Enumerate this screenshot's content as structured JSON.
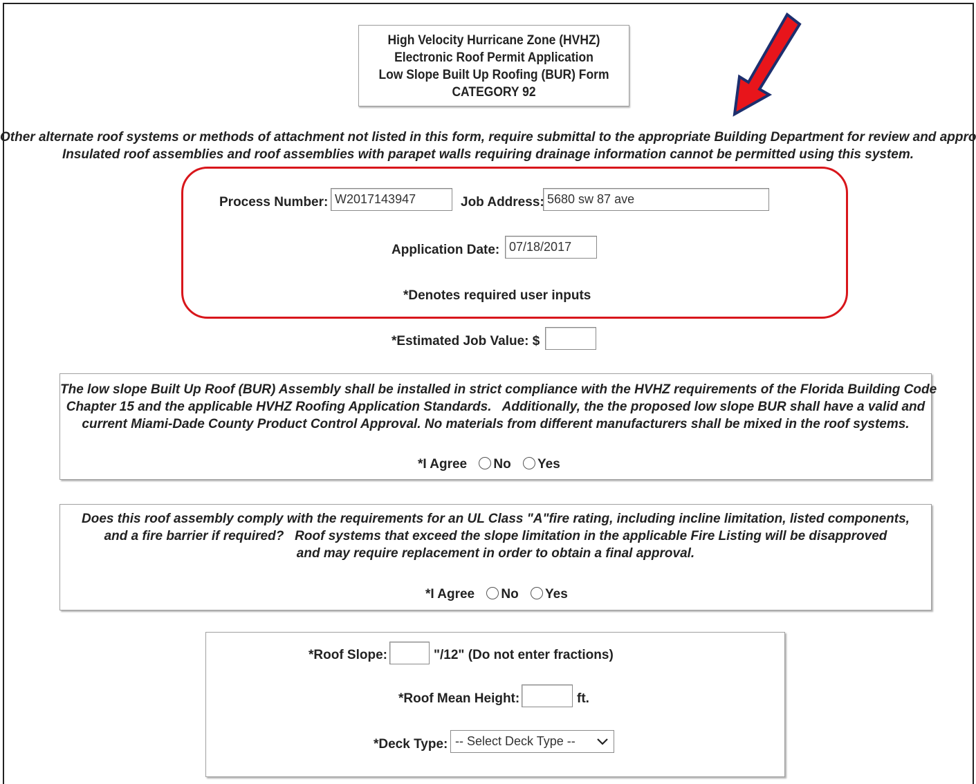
{
  "header": {
    "title_lines": [
      "High Velocity Hurricane Zone (HVHZ)",
      "Electronic Roof Permit Application",
      "Low Slope Built Up Roofing (BUR) Form",
      "CATEGORY 92"
    ]
  },
  "notice": {
    "line1": "Other alternate roof systems or methods of attachment not listed in this form, require submittal to the appropriate Building Department for review and approval.",
    "line2": "Insulated roof assemblies and roof assemblies with parapet walls requiring drainage information cannot be permitted using this system."
  },
  "application": {
    "process_number_label": "Process Number:",
    "process_number_value": "W2017143947",
    "job_address_label": "Job Address:",
    "job_address_value": "5680 sw 87 ave",
    "application_date_label": "Application Date:",
    "application_date_value": "07/18/2017",
    "required_note": "*Denotes required user inputs"
  },
  "job_value": {
    "label": "*Estimated Job Value: $",
    "value": ""
  },
  "agreement1": {
    "lines": [
      "The low slope Built Up Roof (BUR) Assembly shall be installed in strict compliance with the HVHZ requirements of the Florida Building Code",
      "Chapter 15 and the applicable HVHZ Roofing Application Standards.   Additionally, the the proposed low slope BUR shall have a valid and",
      "current Miami-Dade County Product Control Approval. No materials from different manufacturers shall be mixed in the roof systems."
    ],
    "agree_label": "*I Agree",
    "option_no": "No",
    "option_yes": "Yes"
  },
  "agreement2": {
    "lines": [
      "Does this roof assembly comply with the requirements for an UL Class \"A\"fire rating, including incline limitation, listed components,",
      "and a fire barrier if required?   Roof systems that exceed the slope limitation in the applicable Fire Listing will be disapproved",
      "and may require replacement in order to obtain a final approval."
    ],
    "agree_label": "*I Agree",
    "option_no": "No",
    "option_yes": "Yes"
  },
  "roof": {
    "slope_label": "*Roof Slope:",
    "slope_value": "",
    "slope_suffix": "\"/12\" (Do not enter fractions)",
    "height_label": "*Roof Mean Height:",
    "height_value": "",
    "height_suffix": "ft.",
    "deck_label": "*Deck Type:",
    "deck_selected": "-- Select Deck Type --"
  },
  "colors": {
    "highlight_border": "#d8161b",
    "arrow_fill": "#e8151b",
    "arrow_outline": "#1c2f6e"
  },
  "icons": {
    "arrow": "annotation-arrow-icon",
    "select_chevron": "chevron-down-icon"
  }
}
